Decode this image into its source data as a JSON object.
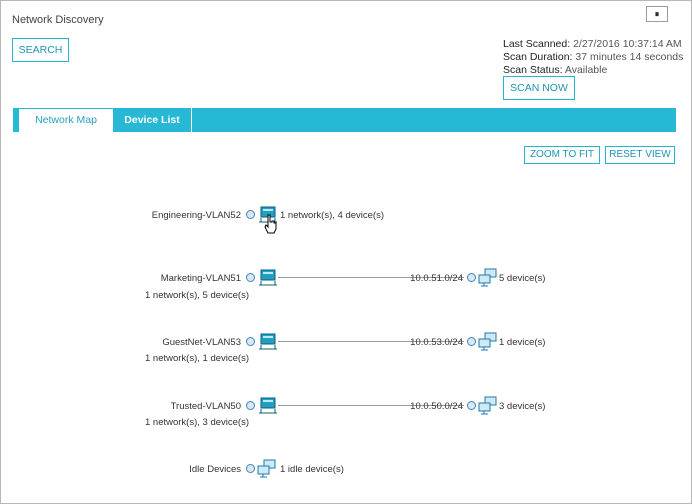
{
  "header": {
    "title": "Network Discovery",
    "pause_glyph": "⏸"
  },
  "search": {
    "label": "SEARCH"
  },
  "scan": {
    "last_scanned_label": "Last Scanned:",
    "last_scanned_value": "2/27/2016 10:37:14 AM",
    "duration_label": "Scan Duration:",
    "duration_value": "37 minutes 14 seconds",
    "status_label": "Scan Status:",
    "status_value": "Available",
    "scan_now_label": "SCAN NOW"
  },
  "tabs": [
    {
      "label": "Network Map",
      "active": true
    },
    {
      "label": "Device List",
      "active": false
    }
  ],
  "toolbar": {
    "zoom_label": "ZOOM TO FIT",
    "reset_label": "RESET VIEW"
  },
  "map": {
    "rows": [
      {
        "name": "Engineering-VLAN52",
        "summary": "1 network(s), 4 device(s)"
      },
      {
        "name": "Marketing-VLAN51",
        "summary": "1 network(s), 5 device(s)",
        "subnet": "10.0.51.0/24",
        "devices": "5 device(s)"
      },
      {
        "name": "GuestNet-VLAN53",
        "summary": "1 network(s), 1 device(s)",
        "subnet": "10.0.53.0/24",
        "devices": "1 device(s)"
      },
      {
        "name": "Trusted-VLAN50",
        "summary": "1 network(s), 3 device(s)",
        "subnet": "10.0.50.0/24",
        "devices": "3 device(s)"
      },
      {
        "name": "Idle Devices",
        "devices": "1 idle device(s)"
      }
    ]
  },
  "icons": {
    "switch": "network-switch-icon",
    "computers": "computer-group-icon",
    "cursor": "hand-cursor-icon"
  },
  "colors": {
    "accent": "#27b8d6",
    "button_text": "#1d95b5",
    "node": "#4682b4"
  }
}
